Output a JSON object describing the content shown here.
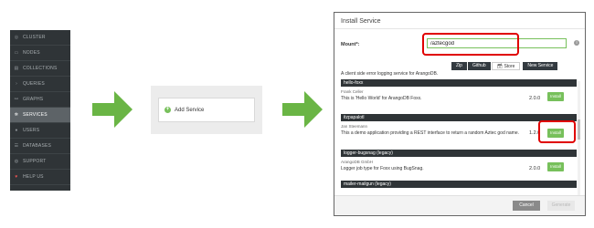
{
  "sidebar": {
    "items": [
      {
        "label": "CLUSTER",
        "icon": "cluster-icon",
        "glyph": "◎"
      },
      {
        "label": "NODES",
        "icon": "nodes-icon",
        "glyph": "▭"
      },
      {
        "label": "COLLECTIONS",
        "icon": "collections-icon",
        "glyph": "▤"
      },
      {
        "label": "QUERIES",
        "icon": "queries-icon",
        "glyph": "›"
      },
      {
        "label": "GRAPHS",
        "icon": "graphs-icon",
        "glyph": "⚯"
      },
      {
        "label": "SERVICES",
        "icon": "services-icon",
        "glyph": "✲",
        "active": true
      },
      {
        "label": "USERS",
        "icon": "users-icon",
        "glyph": "●"
      },
      {
        "label": "DATABASES",
        "icon": "databases-icon",
        "glyph": "☰"
      },
      {
        "label": "SUPPORT",
        "icon": "support-icon",
        "glyph": "◍"
      },
      {
        "label": "HELP US",
        "icon": "heart-icon",
        "glyph": "♥"
      }
    ]
  },
  "add_panel": {
    "label": "Add Service"
  },
  "dialog": {
    "title": "Install Service",
    "mount_label": "Mount*:",
    "mount_value": "/aztecgod",
    "info_glyph": "i",
    "tabs": {
      "zip": "Zip",
      "github": "Github",
      "store": "Store",
      "new_service": "New Service"
    },
    "partial_description": "A client side error logging service for ArangoDB.",
    "services": [
      {
        "name": "hello-foxx",
        "author": "Frank Celler",
        "description": "This is 'Hello World' for ArangoDB Foxx.",
        "version": "2.0.0",
        "install_label": "Install"
      },
      {
        "name": "itzpapalotl",
        "author": "Jan Steemann",
        "description": "This a demo application providing a REST interface to return a random Aztec god name.",
        "version": "1.2.0",
        "install_label": "Install"
      },
      {
        "name": "logger-bugsnag (legacy)",
        "author": "ArangoDB GmbH",
        "description": "Logger job type for Foxx using BugSnag.",
        "version": "2.0.0",
        "install_label": "Install"
      },
      {
        "name": "mailer-mailgun (legacy)"
      }
    ],
    "cancel_label": "Cancel",
    "generate_label": "Generate"
  },
  "colors": {
    "accent_green": "#77c05b",
    "highlight_red": "#e00000",
    "sidebar_bg": "#2f3437"
  }
}
